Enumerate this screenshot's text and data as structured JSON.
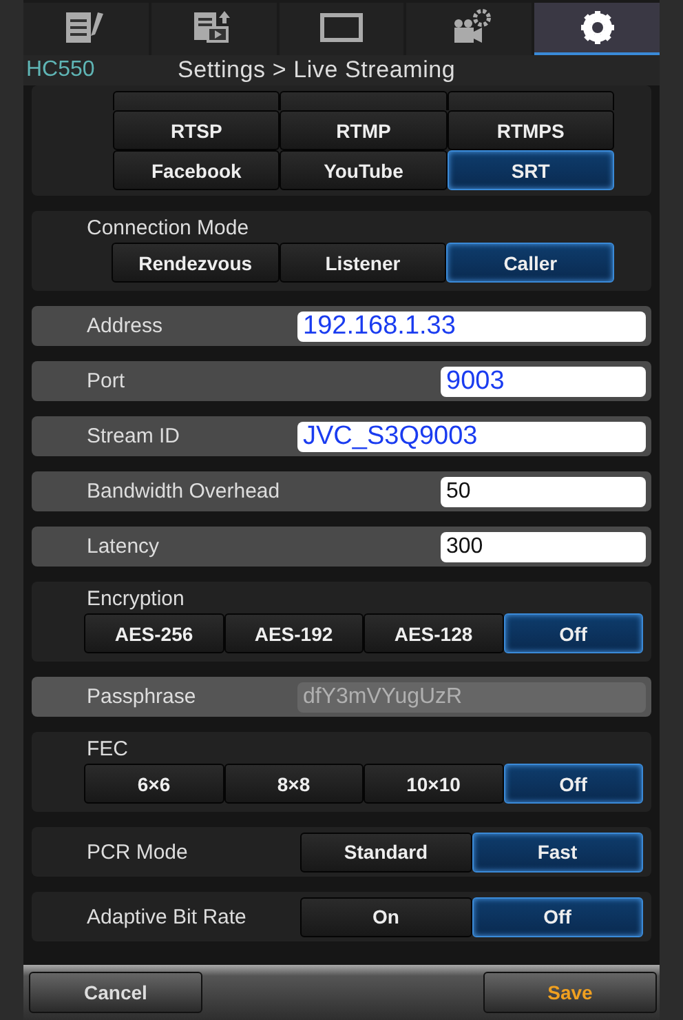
{
  "tabs": [
    {
      "kind": "notes",
      "selected": false
    },
    {
      "kind": "clip",
      "selected": false
    },
    {
      "kind": "monitor",
      "selected": false
    },
    {
      "kind": "camera",
      "selected": false
    },
    {
      "kind": "settings",
      "selected": true
    }
  ],
  "header": {
    "model": "HC550",
    "breadcrumb": "Settings > Live Streaming"
  },
  "sections": [
    {
      "kind": "grid",
      "cut_row": [
        {
          "selected": false
        },
        {
          "selected": false
        },
        {
          "selected": false
        }
      ],
      "options": [
        {
          "label": "RTSP",
          "selected": false
        },
        {
          "label": "RTMP",
          "selected": false
        },
        {
          "label": "RTMPS",
          "selected": false
        },
        {
          "label": "Facebook",
          "selected": false
        },
        {
          "label": "YouTube",
          "selected": false
        },
        {
          "label": "SRT",
          "selected": true
        }
      ]
    },
    {
      "kind": "choice",
      "label": "Connection Mode",
      "options": [
        {
          "label": "Rendezvous",
          "selected": false
        },
        {
          "label": "Listener",
          "selected": false
        },
        {
          "label": "Caller",
          "selected": true
        }
      ]
    },
    {
      "kind": "field",
      "label": "Address",
      "value": "192.168.1.33",
      "highlighted": true,
      "disabled": false
    },
    {
      "kind": "numfield",
      "label": "Port",
      "value": "9003",
      "highlighted": true,
      "disabled": false
    },
    {
      "kind": "field",
      "label": "Stream ID",
      "value": "JVC_S3Q9003",
      "highlighted": true,
      "disabled": false
    },
    {
      "kind": "numfield",
      "label": "Bandwidth Overhead",
      "value": "50",
      "highlighted": false,
      "disabled": false
    },
    {
      "kind": "numfield",
      "label": "Latency",
      "value": "300",
      "highlighted": false,
      "disabled": false
    },
    {
      "kind": "choice",
      "label": "Encryption",
      "options": [
        {
          "label": "AES-256",
          "selected": false
        },
        {
          "label": "AES-192",
          "selected": false
        },
        {
          "label": "AES-128",
          "selected": false
        },
        {
          "label": "Off",
          "selected": true
        }
      ]
    },
    {
      "kind": "field",
      "label": "Passphrase",
      "value": "dfY3mVYugUzR",
      "highlighted": false,
      "disabled": true
    },
    {
      "kind": "choice",
      "label": "FEC",
      "options": [
        {
          "label": "6×6",
          "selected": false
        },
        {
          "label": "8×8",
          "selected": false
        },
        {
          "label": "10×10",
          "selected": false
        },
        {
          "label": "Off",
          "selected": true
        }
      ]
    },
    {
      "kind": "inline",
      "label": "PCR Mode",
      "options": [
        {
          "label": "Standard",
          "selected": false
        },
        {
          "label": "Fast",
          "selected": true
        }
      ]
    },
    {
      "kind": "inline",
      "label": "Adaptive Bit Rate",
      "options": [
        {
          "label": "On",
          "selected": false
        },
        {
          "label": "Off",
          "selected": true
        }
      ]
    }
  ],
  "footer": {
    "cancel": "Cancel",
    "save": "Save"
  }
}
